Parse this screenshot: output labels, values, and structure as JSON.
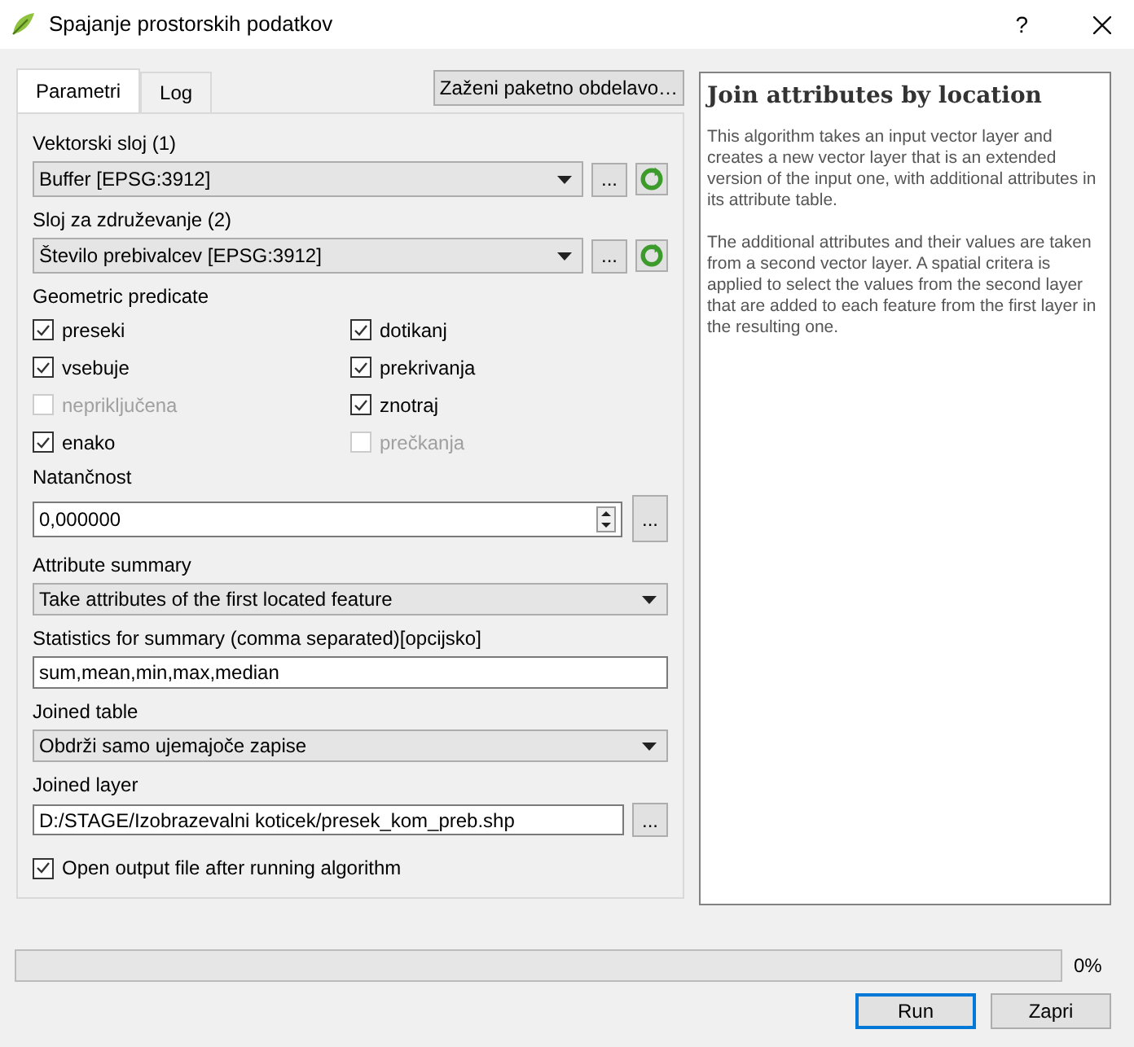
{
  "window": {
    "title": "Spajanje prostorskih podatkov",
    "help": "?"
  },
  "tabs": [
    {
      "label": "Parametri",
      "selected": true
    },
    {
      "label": "Log",
      "selected": false
    }
  ],
  "batch_button": "Zaženi paketno obdelavo…",
  "params": [
    {
      "kind": "layer",
      "label": "Vektorski sloj (1)",
      "value": "Buffer [EPSG:3912]",
      "browse": "..."
    },
    {
      "kind": "layer",
      "label": "Sloj za združevanje (2)",
      "value": "Število prebivalcev [EPSG:3912]",
      "browse": "..."
    },
    {
      "kind": "checks",
      "label": "Geometric predicate",
      "options": [
        {
          "label": "preseki",
          "checked": true,
          "disabled": false
        },
        {
          "label": "dotikanj",
          "checked": true,
          "disabled": false
        },
        {
          "label": "vsebuje",
          "checked": true,
          "disabled": false
        },
        {
          "label": "prekrivanja",
          "checked": true,
          "disabled": false
        },
        {
          "label": "nepriključena",
          "checked": false,
          "disabled": true
        },
        {
          "label": "znotraj",
          "checked": true,
          "disabled": false
        },
        {
          "label": "enako",
          "checked": true,
          "disabled": false
        },
        {
          "label": "prečkanja",
          "checked": false,
          "disabled": true
        }
      ]
    },
    {
      "kind": "spin",
      "label": "Natančnost",
      "value": "0,000000",
      "browse": "..."
    },
    {
      "kind": "select",
      "label": "Attribute summary",
      "value": "Take attributes of the first located feature"
    },
    {
      "kind": "text",
      "label": "Statistics for summary (comma separated)[opcijsko]",
      "value": "sum,mean,min,max,median"
    },
    {
      "kind": "select",
      "label": "Joined table",
      "value": "Obdrži samo ujemajoče zapise"
    },
    {
      "kind": "file",
      "label": "Joined layer",
      "value": "D:/STAGE/Izobrazevalni koticek/presek_kom_preb.shp",
      "browse": "..."
    },
    {
      "kind": "check",
      "label": "Open output file after running algorithm",
      "checked": true
    }
  ],
  "help": {
    "title": "Join attributes by location",
    "paragraphs": [
      "This algorithm takes an input vector layer and creates a new vector layer that is an extended version of the input one, with additional attributes in its attribute table.",
      "The additional attributes and their values are taken from a second vector layer. A spatial critera is applied to select the values from the second layer that are added to each feature from the first layer in the resulting one."
    ]
  },
  "progress": {
    "level": 0,
    "reading": "0%"
  },
  "buttons": [
    {
      "label": "Run",
      "default": true
    },
    {
      "label": "Zapri",
      "default": false
    }
  ]
}
